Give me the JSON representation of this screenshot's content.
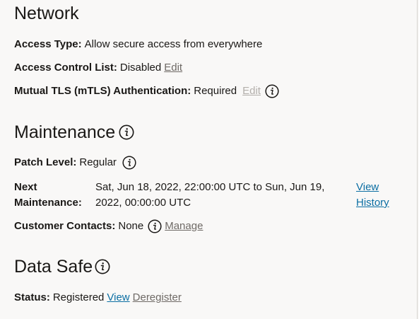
{
  "network": {
    "title": "Network",
    "access_type_label": "Access Type:",
    "access_type_value": "Allow secure access from everywhere",
    "acl_label": "Access Control List:",
    "acl_value": "Disabled",
    "acl_edit": "Edit",
    "mtls_label": "Mutual TLS (mTLS) Authentication:",
    "mtls_value": "Required",
    "mtls_edit": "Edit"
  },
  "maintenance": {
    "title": "Maintenance",
    "patch_label": "Patch Level:",
    "patch_value": "Regular",
    "next_label_line1": "Next",
    "next_label_line2": "Maintenance:",
    "next_value_line1": "Sat, Jun 18, 2022, 22:00:00 UTC to Sun, Jun 19,",
    "next_value_line2": "2022, 00:00:00 UTC",
    "view_history_line1": "View",
    "view_history_line2": "History",
    "contacts_label": "Customer Contacts:",
    "contacts_value": "None",
    "contacts_manage": "Manage"
  },
  "data_safe": {
    "title": "Data Safe",
    "status_label": "Status:",
    "status_value": "Registered",
    "view": "View",
    "deregister": "Deregister"
  },
  "colors": {
    "background": "#f9f8f7",
    "text": "#1a1816",
    "link_blue": "#0b6ea3",
    "link_gray": "#6f6a66",
    "link_disabled": "#b3afab"
  },
  "icons": {
    "info": "info-circle-icon"
  }
}
